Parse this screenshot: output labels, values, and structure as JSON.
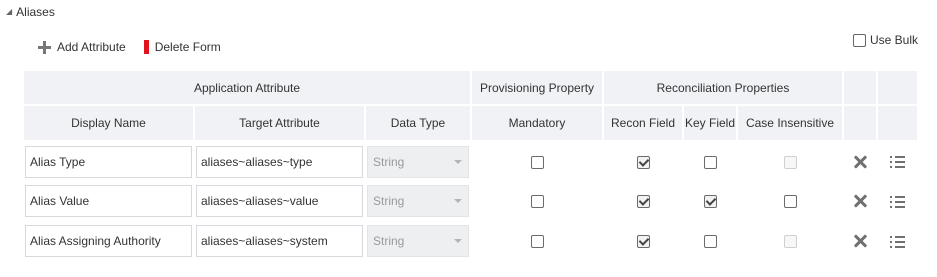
{
  "section": {
    "title": "Aliases",
    "expanded_icon": "collapse-triangle-icon"
  },
  "toolbar": {
    "add_attribute_label": "Add Attribute",
    "add_attribute_icon": "plus-icon",
    "delete_form_label": "Delete Form",
    "delete_form_icon": "red-bar-icon",
    "delete_form_color": "#e0141e"
  },
  "bulk": {
    "label": "Use Bulk",
    "checked": false
  },
  "table": {
    "group_headers": {
      "application_attribute": "Application Attribute",
      "provisioning_property": "Provisioning Property",
      "reconciliation_properties": "Reconciliation Properties"
    },
    "columns": {
      "display_name": "Display Name",
      "target_attribute": "Target Attribute",
      "data_type": "Data Type",
      "mandatory": "Mandatory",
      "recon_field": "Recon Field",
      "key_field": "Key Field",
      "case_insensitive": "Case Insensitive"
    },
    "rows": [
      {
        "display_name": "Alias Type",
        "target_attribute": "aliases~aliases~type",
        "data_type": "String",
        "mandatory": false,
        "recon_field": true,
        "key_field": false,
        "case_insensitive": false,
        "case_insensitive_disabled": true
      },
      {
        "display_name": "Alias Value",
        "target_attribute": "aliases~aliases~value",
        "data_type": "String",
        "mandatory": false,
        "recon_field": true,
        "key_field": true,
        "case_insensitive": false,
        "case_insensitive_disabled": false
      },
      {
        "display_name": "Alias Assigning Authority",
        "target_attribute": "aliases~aliases~system",
        "data_type": "String",
        "mandatory": false,
        "recon_field": true,
        "key_field": false,
        "case_insensitive": false,
        "case_insensitive_disabled": true
      }
    ],
    "row_actions": {
      "delete_icon": "close-icon",
      "details_icon": "list-icon"
    }
  }
}
